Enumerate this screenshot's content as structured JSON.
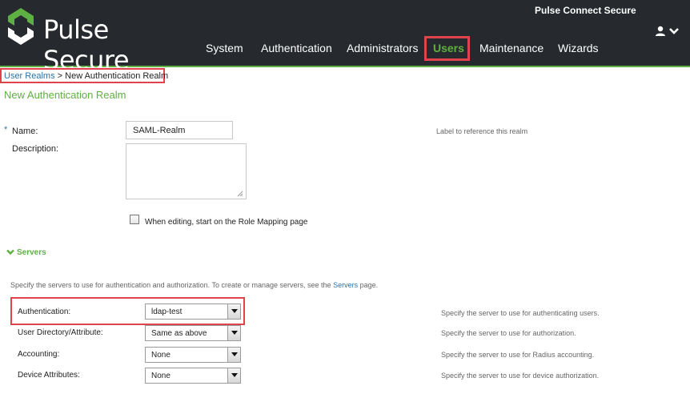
{
  "header": {
    "logo_text": "Pulse Secure",
    "product_name": "Pulse Connect Secure",
    "nav": [
      {
        "label": "System"
      },
      {
        "label": "Authentication"
      },
      {
        "label": "Administrators"
      },
      {
        "label": "Users",
        "active": true
      },
      {
        "label": "Maintenance"
      },
      {
        "label": "Wizards"
      }
    ]
  },
  "breadcrumb": {
    "link": "User Realms",
    "separator": ">",
    "current": "New Authentication Realm"
  },
  "page_title": "New Authentication Realm",
  "form": {
    "required_marker": "*",
    "name_label": "Name:",
    "name_value": "SAML-Realm",
    "name_help": "Label to reference this realm",
    "description_label": "Description:",
    "description_value": "",
    "role_mapping_checkbox_label": "When editing, start on the Role Mapping page",
    "role_mapping_checked": false
  },
  "servers": {
    "section_label": "Servers",
    "desc_prefix": "Specify the servers to use for authentication and authorization. To create or manage servers, see the ",
    "desc_link": "Servers",
    "desc_suffix": " page.",
    "rows": [
      {
        "label": "Authentication:",
        "value": "ldap-test",
        "help": "Specify the server to use for authenticating users."
      },
      {
        "label": "User Directory/Attribute:",
        "value": "Same as above",
        "help": "Specify the server to use for authorization."
      },
      {
        "label": "Accounting:",
        "value": "None",
        "help": "Specify the server to use for Radius accounting."
      },
      {
        "label": "Device Attributes:",
        "value": "None",
        "help": "Specify the server to use for device authorization."
      }
    ]
  },
  "colors": {
    "brand_green": "#5fb043",
    "header_bg": "#262a2e",
    "highlight_red": "#e0434b",
    "link_blue": "#2b72a8"
  },
  "icons": [
    "pulse-logo-icon",
    "user-icon",
    "chevron-down-icon",
    "resize-grip-icon",
    "dropdown-arrow-icon"
  ]
}
